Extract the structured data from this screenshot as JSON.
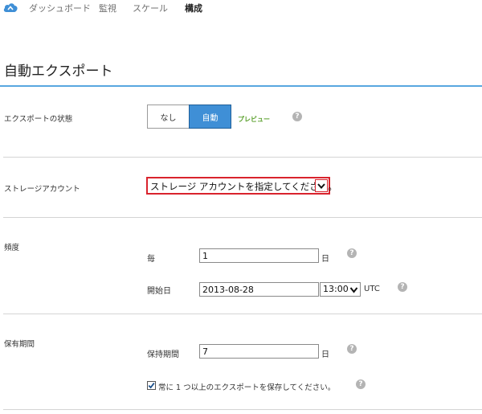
{
  "nav": {
    "items": [
      {
        "label": "ダッシュボード",
        "active": false
      },
      {
        "label": "監視",
        "active": false
      },
      {
        "label": "スケール",
        "active": false
      },
      {
        "label": "構成",
        "active": true
      }
    ]
  },
  "page": {
    "title": "自動エクスポート"
  },
  "export_state": {
    "label": "エクスポートの状態",
    "options": [
      "なし",
      "自動"
    ],
    "selected": "自動",
    "preview_badge": "プレビュー"
  },
  "storage": {
    "label": "ストレージアカウント",
    "value": "ストレージ アカウントを指定してください。"
  },
  "frequency": {
    "label": "頻度",
    "every_label": "毎",
    "every_value": "1",
    "every_unit": "日",
    "start_label": "開始日",
    "start_date": "2013-08-28",
    "start_time": "13:00",
    "timezone": "UTC"
  },
  "retention": {
    "label": "保有期間",
    "keep_label": "保持期間",
    "keep_value": "7",
    "keep_unit": "日",
    "always_keep_label": "常に 1 つ以上のエクスポートを保存してください。",
    "always_keep_checked": true
  },
  "icons": {
    "help": "?"
  },
  "colors": {
    "accent": "#3f8fd6",
    "rule": "#58a7e0",
    "error": "#d9232d",
    "preview": "#5aa02c"
  }
}
